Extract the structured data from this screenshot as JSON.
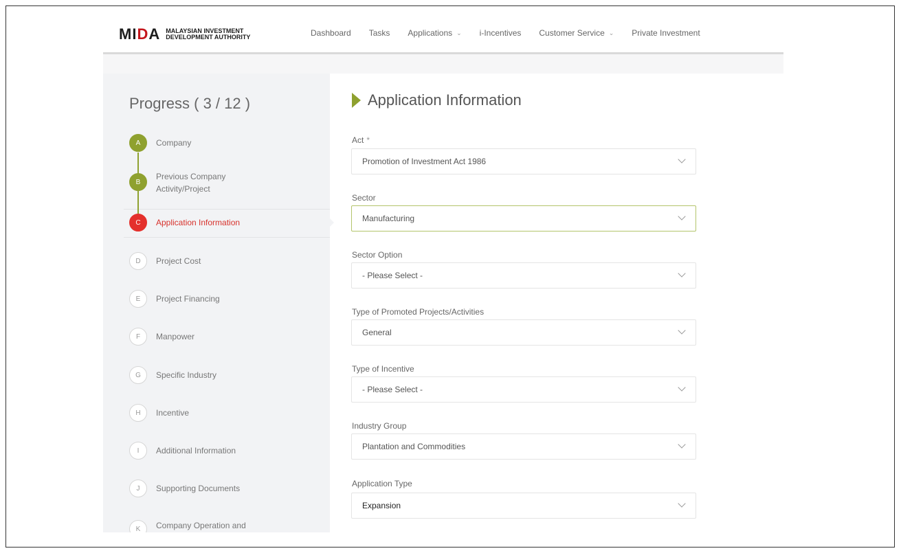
{
  "header": {
    "logo_mark_1": "MI",
    "logo_mark_2": "D",
    "logo_mark_3": "A",
    "logo_line_1": "MALAYSIAN INVESTMENT",
    "logo_line_2": "DEVELOPMENT AUTHORITY",
    "nav": [
      {
        "label": "Dashboard",
        "has_dropdown": false
      },
      {
        "label": "Tasks",
        "has_dropdown": false
      },
      {
        "label": "Applications",
        "has_dropdown": true
      },
      {
        "label": "i-Incentives",
        "has_dropdown": false
      },
      {
        "label": "Customer Service",
        "has_dropdown": true
      },
      {
        "label": "Private Investment",
        "has_dropdown": false
      }
    ]
  },
  "progress": {
    "title": "Progress ( 3 / 12 )",
    "steps": [
      {
        "letter": "A",
        "label": "Company",
        "state": "done"
      },
      {
        "letter": "B",
        "label": "Previous Company Activity/Project",
        "state": "done"
      },
      {
        "letter": "C",
        "label": "Application Information",
        "state": "active"
      },
      {
        "letter": "D",
        "label": "Project Cost",
        "state": "pending"
      },
      {
        "letter": "E",
        "label": "Project Financing",
        "state": "pending"
      },
      {
        "letter": "F",
        "label": "Manpower",
        "state": "pending"
      },
      {
        "letter": "G",
        "label": "Specific Industry",
        "state": "pending"
      },
      {
        "letter": "H",
        "label": "Incentive",
        "state": "pending"
      },
      {
        "letter": "I",
        "label": "Additional Information",
        "state": "pending"
      },
      {
        "letter": "J",
        "label": "Supporting Documents",
        "state": "pending"
      },
      {
        "letter": "K",
        "label": "Company Operation and",
        "state": "pending"
      }
    ]
  },
  "form": {
    "title": "Application Information",
    "fields": [
      {
        "label": "Act",
        "required": "*",
        "value": "Promotion of Investment Act 1986"
      },
      {
        "label": "Sector",
        "required": "",
        "value": "Manufacturing"
      },
      {
        "label": "Sector Option",
        "required": "",
        "value": "- Please Select -"
      },
      {
        "label": "Type of Promoted Projects/Activities",
        "required": "",
        "value": "General"
      },
      {
        "label": "Type of Incentive",
        "required": "",
        "value": "- Please Select -"
      },
      {
        "label": "Industry Group",
        "required": "",
        "value": "Plantation and Commodities"
      },
      {
        "label": "Application Type",
        "required": "",
        "value": "Expansion"
      }
    ]
  },
  "colors": {
    "done": "#8fa12f",
    "active": "#e4302c",
    "accent": "#8fa12f"
  }
}
